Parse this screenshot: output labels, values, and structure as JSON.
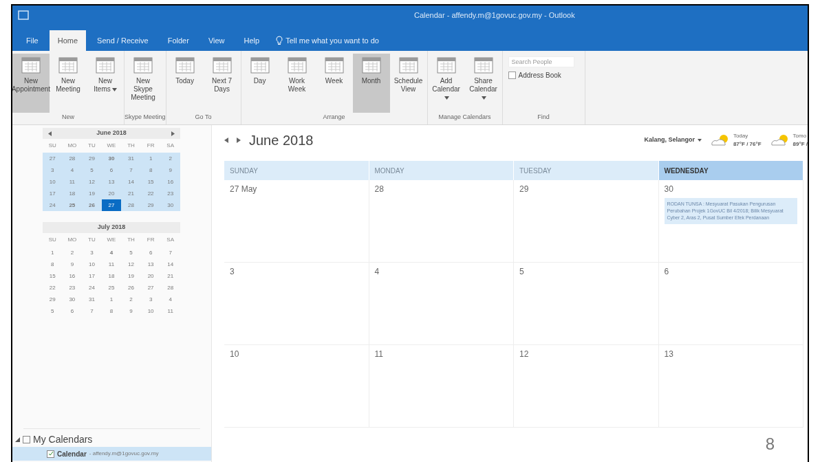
{
  "window": {
    "title": "Calendar - affendy.m@1govuc.gov.my - Outlook"
  },
  "tabs": [
    {
      "label": "File",
      "selected": false
    },
    {
      "label": "Home",
      "selected": true
    },
    {
      "label": "Send / Receive",
      "selected": false
    },
    {
      "label": "Folder",
      "selected": false
    },
    {
      "label": "View",
      "selected": false
    },
    {
      "label": "Help",
      "selected": false
    }
  ],
  "tell_me": "Tell me what you want to do",
  "ribbon_groups": [
    {
      "label": "New",
      "buttons": [
        {
          "label": "New Appointment",
          "selected": true,
          "dropdown": false
        },
        {
          "label": "New Meeting",
          "selected": false,
          "dropdown": false
        },
        {
          "label": "New Items",
          "selected": false,
          "dropdown": true
        }
      ]
    },
    {
      "label": "Skype Meeting",
      "buttons": [
        {
          "label": "New Skype Meeting",
          "selected": false,
          "dropdown": false
        }
      ]
    },
    {
      "label": "Go To",
      "buttons": [
        {
          "label": "Today",
          "selected": false,
          "dropdown": false
        },
        {
          "label": "Next 7 Days",
          "selected": false,
          "dropdown": false
        }
      ]
    },
    {
      "label": "Arrange",
      "buttons": [
        {
          "label": "Day",
          "selected": false,
          "dropdown": false
        },
        {
          "label": "Work Week",
          "selected": false,
          "dropdown": false
        },
        {
          "label": "Week",
          "selected": false,
          "dropdown": false
        },
        {
          "label": "Month",
          "selected": true,
          "dropdown": false
        },
        {
          "label": "Schedule View",
          "selected": false,
          "dropdown": false
        }
      ]
    },
    {
      "label": "Manage Calendars",
      "buttons": [
        {
          "label": "Add Calendar",
          "selected": false,
          "dropdown": true
        },
        {
          "label": "Share Calendar",
          "selected": false,
          "dropdown": true
        }
      ]
    }
  ],
  "find": {
    "label": "Find",
    "search_placeholder": "Search People",
    "address_book": "Address Book"
  },
  "mini_calendars": [
    {
      "title": "June 2018",
      "weekdays": [
        "SU",
        "MO",
        "TU",
        "WE",
        "TH",
        "FR",
        "SA"
      ],
      "weeks": [
        [
          {
            "d": "27",
            "bold": false,
            "selected": false
          },
          {
            "d": "28",
            "bold": false,
            "selected": false
          },
          {
            "d": "29",
            "bold": false,
            "selected": false
          },
          {
            "d": "30",
            "bold": true,
            "selected": false
          },
          {
            "d": "31",
            "bold": false,
            "selected": false
          },
          {
            "d": "1",
            "bold": false,
            "selected": false
          },
          {
            "d": "2",
            "bold": false,
            "selected": false
          }
        ],
        [
          {
            "d": "3",
            "bold": false,
            "selected": false
          },
          {
            "d": "4",
            "bold": false,
            "selected": false
          },
          {
            "d": "5",
            "bold": false,
            "selected": false
          },
          {
            "d": "6",
            "bold": false,
            "selected": false
          },
          {
            "d": "7",
            "bold": false,
            "selected": false
          },
          {
            "d": "8",
            "bold": false,
            "selected": false
          },
          {
            "d": "9",
            "bold": false,
            "selected": false
          }
        ],
        [
          {
            "d": "10",
            "bold": false,
            "selected": false
          },
          {
            "d": "11",
            "bold": false,
            "selected": false
          },
          {
            "d": "12",
            "bold": false,
            "selected": false
          },
          {
            "d": "13",
            "bold": false,
            "selected": false
          },
          {
            "d": "14",
            "bold": false,
            "selected": false
          },
          {
            "d": "15",
            "bold": false,
            "selected": false
          },
          {
            "d": "16",
            "bold": false,
            "selected": false
          }
        ],
        [
          {
            "d": "17",
            "bold": false,
            "selected": false
          },
          {
            "d": "18",
            "bold": false,
            "selected": false
          },
          {
            "d": "19",
            "bold": false,
            "selected": false
          },
          {
            "d": "20",
            "bold": false,
            "selected": false
          },
          {
            "d": "21",
            "bold": false,
            "selected": false
          },
          {
            "d": "22",
            "bold": false,
            "selected": false
          },
          {
            "d": "23",
            "bold": false,
            "selected": false
          }
        ],
        [
          {
            "d": "24",
            "bold": false,
            "selected": false
          },
          {
            "d": "25",
            "bold": true,
            "selected": false
          },
          {
            "d": "26",
            "bold": true,
            "selected": false
          },
          {
            "d": "27",
            "bold": false,
            "selected": true
          },
          {
            "d": "28",
            "bold": false,
            "selected": false
          },
          {
            "d": "29",
            "bold": false,
            "selected": false
          },
          {
            "d": "30",
            "bold": false,
            "selected": false
          }
        ]
      ],
      "in_range": true
    },
    {
      "title": "July 2018",
      "weekdays": [
        "SU",
        "MO",
        "TU",
        "WE",
        "TH",
        "FR",
        "SA"
      ],
      "weeks": [
        [
          {
            "d": "1",
            "bold": false,
            "selected": false
          },
          {
            "d": "2",
            "bold": false,
            "selected": false
          },
          {
            "d": "3",
            "bold": false,
            "selected": false
          },
          {
            "d": "4",
            "bold": true,
            "selected": false
          },
          {
            "d": "5",
            "bold": false,
            "selected": false
          },
          {
            "d": "6",
            "bold": false,
            "selected": false
          },
          {
            "d": "7",
            "bold": false,
            "selected": false
          }
        ],
        [
          {
            "d": "8",
            "bold": false,
            "selected": false
          },
          {
            "d": "9",
            "bold": false,
            "selected": false
          },
          {
            "d": "10",
            "bold": false,
            "selected": false
          },
          {
            "d": "11",
            "bold": false,
            "selected": false
          },
          {
            "d": "12",
            "bold": false,
            "selected": false
          },
          {
            "d": "13",
            "bold": false,
            "selected": false
          },
          {
            "d": "14",
            "bold": false,
            "selected": false
          }
        ],
        [
          {
            "d": "15",
            "bold": false,
            "selected": false
          },
          {
            "d": "16",
            "bold": false,
            "selected": false
          },
          {
            "d": "17",
            "bold": false,
            "selected": false
          },
          {
            "d": "18",
            "bold": false,
            "selected": false
          },
          {
            "d": "19",
            "bold": false,
            "selected": false
          },
          {
            "d": "20",
            "bold": false,
            "selected": false
          },
          {
            "d": "21",
            "bold": false,
            "selected": false
          }
        ],
        [
          {
            "d": "22",
            "bold": false,
            "selected": false
          },
          {
            "d": "23",
            "bold": false,
            "selected": false
          },
          {
            "d": "24",
            "bold": false,
            "selected": false
          },
          {
            "d": "25",
            "bold": false,
            "selected": false
          },
          {
            "d": "26",
            "bold": false,
            "selected": false
          },
          {
            "d": "27",
            "bold": false,
            "selected": false
          },
          {
            "d": "28",
            "bold": false,
            "selected": false
          }
        ],
        [
          {
            "d": "29",
            "bold": false,
            "selected": false
          },
          {
            "d": "30",
            "bold": false,
            "selected": false
          },
          {
            "d": "31",
            "bold": false,
            "selected": false
          },
          {
            "d": "1",
            "bold": false,
            "selected": false
          },
          {
            "d": "2",
            "bold": false,
            "selected": false
          },
          {
            "d": "3",
            "bold": false,
            "selected": false
          },
          {
            "d": "4",
            "bold": false,
            "selected": false
          }
        ],
        [
          {
            "d": "5",
            "bold": false,
            "selected": false
          },
          {
            "d": "6",
            "bold": false,
            "selected": false
          },
          {
            "d": "7",
            "bold": false,
            "selected": false
          },
          {
            "d": "8",
            "bold": false,
            "selected": false
          },
          {
            "d": "9",
            "bold": false,
            "selected": false
          },
          {
            "d": "10",
            "bold": false,
            "selected": false
          },
          {
            "d": "11",
            "bold": false,
            "selected": false
          }
        ]
      ],
      "in_range": false
    }
  ],
  "folders": {
    "group": "My Calendars",
    "expanded": true,
    "items": [
      {
        "name": "Calendar",
        "account": "- affendy.m@1govuc.gov.my",
        "checked": true,
        "selected": true
      }
    ]
  },
  "calendar": {
    "title": "June 2018",
    "location": "Kalang, Selangor",
    "weather": [
      {
        "day": "Today",
        "temp": "87°F / 76°F"
      },
      {
        "day": "Tomo",
        "temp": "89°F /"
      }
    ],
    "columns": [
      {
        "label": "SUNDAY",
        "selected": false
      },
      {
        "label": "MONDAY",
        "selected": false
      },
      {
        "label": "TUESDAY",
        "selected": false
      },
      {
        "label": "WEDNESDAY",
        "selected": true
      }
    ],
    "weeks": [
      [
        {
          "date": "27 May"
        },
        {
          "date": "28"
        },
        {
          "date": "29"
        },
        {
          "date": "30",
          "events": [
            "RODAN TUNSA : Mesyuarat Pasukan Pengurusan Perubahan Projek 1GovUC Bil 4/2018; Bilik Mesyuarat Cyber 2, Aras 2, Pusat Sumber Efek Perdanaan"
          ]
        }
      ],
      [
        {
          "date": "3"
        },
        {
          "date": "4"
        },
        {
          "date": "5"
        },
        {
          "date": "6"
        }
      ],
      [
        {
          "date": "10"
        },
        {
          "date": "11"
        },
        {
          "date": "12"
        },
        {
          "date": "13"
        }
      ]
    ]
  },
  "slide_number": "8"
}
